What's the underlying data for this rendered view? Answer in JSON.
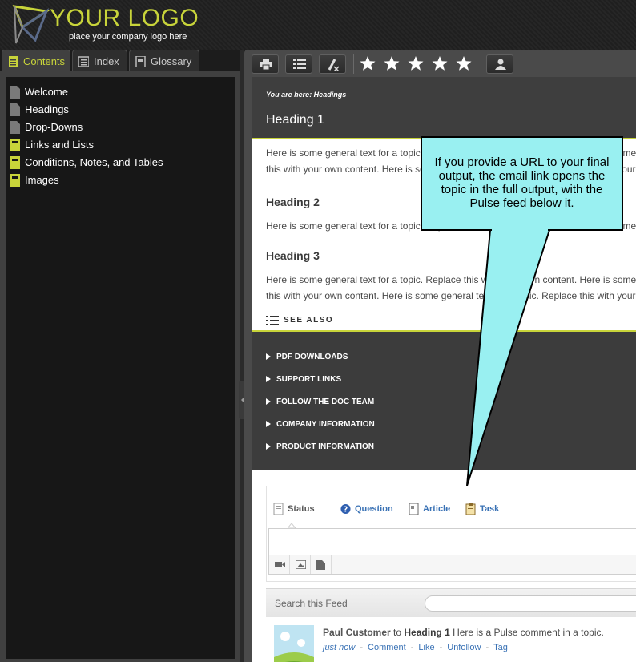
{
  "logo": {
    "title": "YOUR LOGO",
    "tagline": "place your company logo here"
  },
  "nav_tabs": [
    {
      "label": "Contents",
      "icon": "document-icon",
      "active": true
    },
    {
      "label": "Index",
      "icon": "list-icon",
      "active": false
    },
    {
      "label": "Glossary",
      "icon": "book-icon",
      "active": false
    }
  ],
  "toc": [
    {
      "label": "Welcome",
      "icon": "document-icon"
    },
    {
      "label": "Headings",
      "icon": "document-icon"
    },
    {
      "label": "Drop-Downs",
      "icon": "document-icon"
    },
    {
      "label": "Links and Lists",
      "icon": "book-icon"
    },
    {
      "label": "Conditions, Notes, and Tables",
      "icon": "book-icon"
    },
    {
      "label": "Images",
      "icon": "book-icon"
    }
  ],
  "toolbar": {
    "icons": [
      "print-icon",
      "list-icon",
      "remove-highlight-icon",
      "star-icon",
      "user-icon"
    ],
    "stars": 5
  },
  "topic": {
    "breadcrumb": "You are here: Headings",
    "heading1": "Heading 1",
    "para1_line1": "Here is some general text for a topic. Replace this with your own content. Here is some general text for a topic. Replace",
    "para1_line2": "this with your own content. Here is some general text for a topic. Replace this with your own content. Here is some general",
    "heading2": "Heading 2",
    "para2": "Here is some general text for a topic. Replace this with your own content. Here is some general text for a topic. Replace",
    "heading3": "Heading 3",
    "para3_line1": "Here is some general text for a topic. Replace this with your own content. Here is some general text for a topic. Replace",
    "para3_line2": "this with your own content. Here is some general text for a topic. Replace this with your own content.",
    "see_also": "SEE ALSO"
  },
  "footer_links": [
    "PDF DOWNLOADS",
    "SUPPORT LINKS",
    "FOLLOW THE DOC TEAM",
    "COMPANY INFORMATION",
    "PRODUCT INFORMATION"
  ],
  "pulse": {
    "tabs": [
      "Status",
      "Question",
      "Article",
      "Task"
    ],
    "attach_icons": [
      "video-icon",
      "image-icon",
      "file-icon"
    ],
    "search_label": "Search this Feed",
    "post": {
      "author": "Paul Customer",
      "connector": "to",
      "topic": "Heading 1",
      "text": "Here is a Pulse comment in a topic.",
      "time": "just now",
      "actions": [
        "Comment",
        "Like",
        "Unfollow",
        "Tag"
      ]
    }
  },
  "callout": {
    "text": "If you provide a URL to your final output, the email link opens the topic in the full output, with the Pulse feed below it."
  },
  "colors": {
    "accent": "#c8d43a",
    "callout": "#99f0f1",
    "link": "#3a72b5"
  }
}
